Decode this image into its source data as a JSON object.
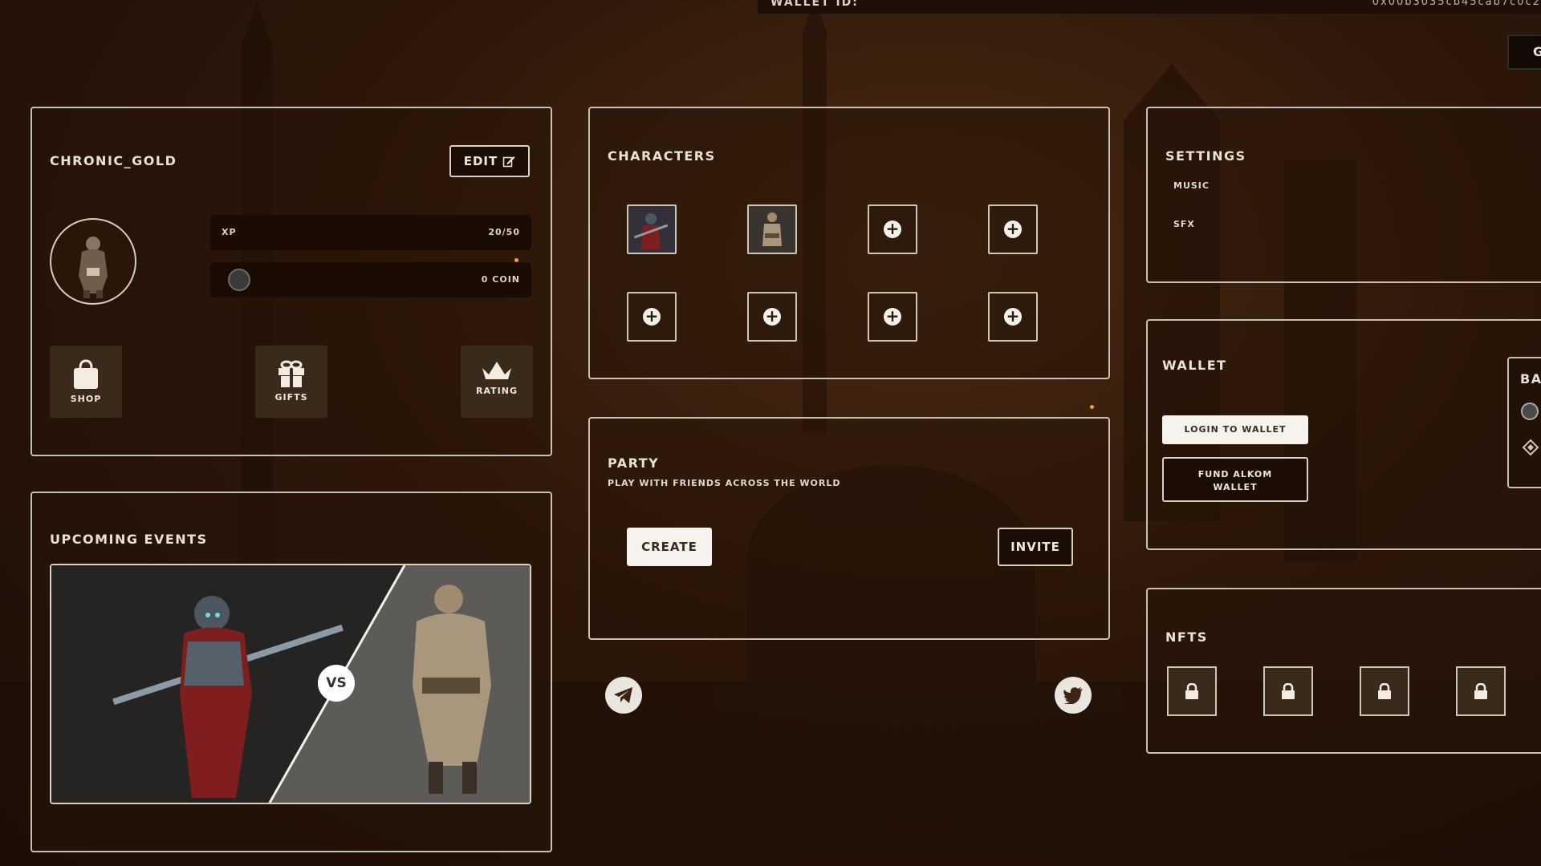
{
  "top_bar": {
    "wallet_label": "WALLET ID:",
    "wallet_id": "0x00b3035cb45cab7c0c2"
  },
  "corner_button": {
    "label": "G"
  },
  "profile": {
    "username": "CHRONIC_GOLD",
    "edit_label": "EDIT",
    "xp_label": "XP",
    "xp_value": "20/50",
    "xp_progress": 0.4,
    "coin_value": "0 COIN",
    "tiles": [
      {
        "label": "SHOP",
        "icon": "shopping-bag-icon"
      },
      {
        "label": "GIFTS",
        "icon": "gift-icon"
      },
      {
        "label": "RATING",
        "icon": "crown-icon"
      }
    ]
  },
  "events": {
    "title": "UPCOMING EVENTS",
    "vs_label": "VS"
  },
  "characters": {
    "title": "CHARACTERS",
    "slots": [
      {
        "state": "filled",
        "name": "character-armored-knight"
      },
      {
        "state": "filled",
        "name": "character-barbarian"
      },
      {
        "state": "empty"
      },
      {
        "state": "empty"
      },
      {
        "state": "empty"
      },
      {
        "state": "empty"
      },
      {
        "state": "empty"
      },
      {
        "state": "empty"
      }
    ]
  },
  "party": {
    "title": "PARTY",
    "subtitle": "PLAY WITH FRIENDS ACROSS THE WORLD",
    "create_label": "CREATE",
    "invite_label": "INVITE"
  },
  "social": [
    {
      "name": "telegram-icon"
    },
    {
      "name": "twitter-icon"
    }
  ],
  "settings": {
    "title": "SETTINGS",
    "music_label": "MUSIC",
    "sfx_label": "SFX"
  },
  "wallet": {
    "title": "WALLET",
    "login_label": "LOGIN TO WALLET",
    "fund_label": "FUND ALKOM WALLET",
    "balance_title": "BA"
  },
  "nfts": {
    "title": "NFTS",
    "slot_count": 4
  },
  "colors": {
    "panel_border": "#c9c0b5",
    "background": "#2d170a",
    "accent_orange": "#f0a030"
  }
}
